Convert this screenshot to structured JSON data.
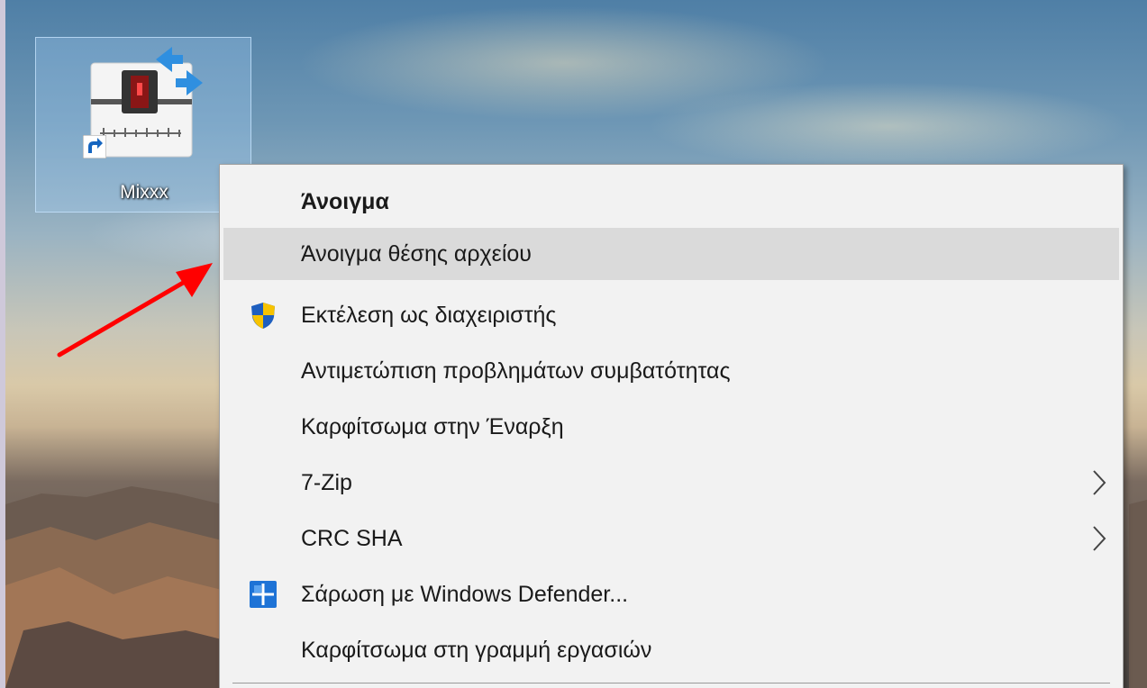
{
  "desktop": {
    "shortcut": {
      "label": "Mixxx",
      "icon": "mixxx-app-icon",
      "overlay": "shortcut-arrow-icon"
    }
  },
  "context_menu": {
    "items": [
      {
        "label": "Άνοιγμα",
        "bold": true
      },
      {
        "label": "Άνοιγμα θέσης αρχείου",
        "highlighted": true
      },
      {
        "label": "Εκτέλεση ως διαχειριστής",
        "icon": "uac-shield-icon"
      },
      {
        "label": "Αντιμετώπιση προβλημάτων συμβατότητας"
      },
      {
        "label": "Καρφίτσωμα στην Έναρξη"
      },
      {
        "label": "7-Zip",
        "submenu": true
      },
      {
        "label": "CRC SHA",
        "submenu": true
      },
      {
        "label": "Σάρωση με Windows Defender...",
        "icon": "windows-defender-icon"
      },
      {
        "label": "Καρφίτσωμα στη γραμμή εργασιών"
      }
    ]
  },
  "annotation": {
    "arrow_color": "#ff0000"
  },
  "colors": {
    "menu_bg": "#f2f2f2",
    "hover_bg": "#dadada",
    "selection_bg": "rgba(173,214,255,0.28)"
  }
}
